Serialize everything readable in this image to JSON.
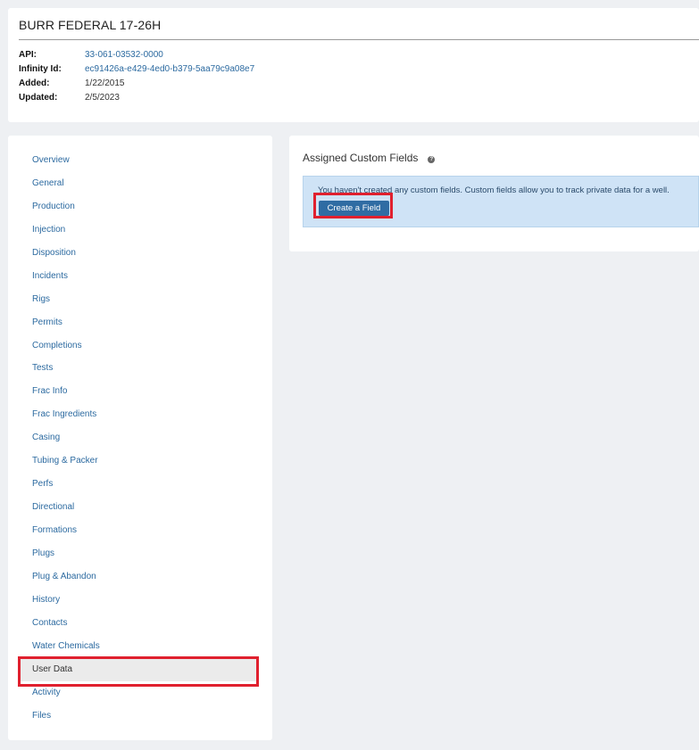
{
  "well": {
    "title": "BURR FEDERAL 17-26H",
    "meta": [
      {
        "label": "API:",
        "value": "33-061-03532-0000",
        "link": true
      },
      {
        "label": "Infinity Id:",
        "value": "ec91426a-e429-4ed0-b379-5aa79c9a08e7",
        "link": true
      },
      {
        "label": "Added:",
        "value": "1/22/2015",
        "link": false
      },
      {
        "label": "Updated:",
        "value": "2/5/2023",
        "link": false
      }
    ]
  },
  "nav": {
    "items": [
      "Overview",
      "General",
      "Production",
      "Injection",
      "Disposition",
      "Incidents",
      "Rigs",
      "Permits",
      "Completions",
      "Tests",
      "Frac Info",
      "Frac Ingredients",
      "Casing",
      "Tubing & Packer",
      "Perfs",
      "Directional",
      "Formations",
      "Plugs",
      "Plug & Abandon",
      "History",
      "Contacts",
      "Water Chemicals",
      "User Data",
      "Activity",
      "Files"
    ],
    "active": "User Data"
  },
  "custom_fields": {
    "title": "Assigned Custom Fields",
    "help_icon": "question-circle-icon",
    "info_text": "You haven't created any custom fields. Custom fields allow you to track private data for a well.",
    "create_button_label": "Create a Field"
  },
  "colors": {
    "link": "#2c6aa0",
    "highlight": "#e0202e",
    "info_bg": "#cfe3f6",
    "button": "#2f6ca3"
  }
}
